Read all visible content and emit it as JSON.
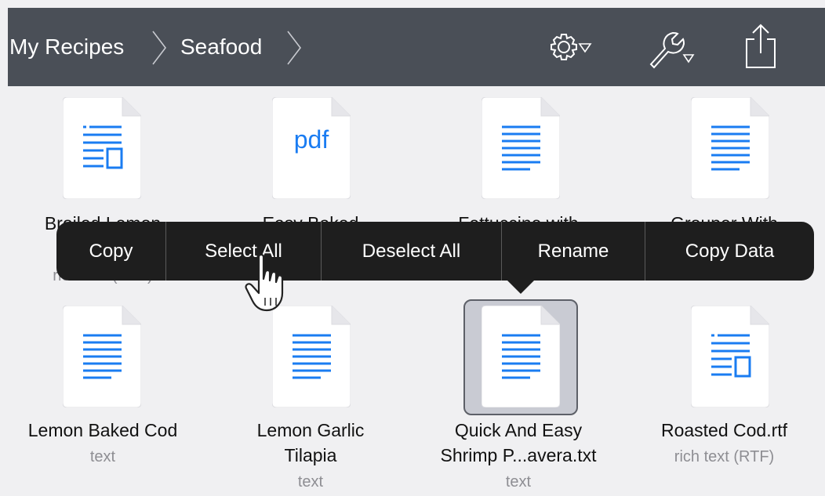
{
  "breadcrumb": {
    "items": [
      {
        "label": "My Recipes"
      },
      {
        "label": "Seafood"
      }
    ]
  },
  "toolbar": {
    "icons": [
      "gear-dropdown-icon",
      "wrench-dropdown-icon",
      "share-icon"
    ]
  },
  "files": [
    {
      "name_lines": [
        "Broiled Lemon"
      ],
      "type": "rich text (RTF)",
      "icon": "rich-text-doc-icon"
    },
    {
      "name_lines": [
        "Easy Baked"
      ],
      "type": "",
      "icon": "pdf-doc-icon",
      "icon_text": "pdf"
    },
    {
      "name_lines": [
        "Fettuccine with"
      ],
      "type": "",
      "icon": "text-doc-icon"
    },
    {
      "name_lines": [
        "Grouper With"
      ],
      "type": "",
      "icon": "text-doc-icon"
    },
    {
      "name_lines": [
        "Lemon Baked Cod"
      ],
      "type": "text",
      "icon": "text-doc-icon"
    },
    {
      "name_lines": [
        "Lemon Garlic",
        "Tilapia"
      ],
      "type": "text",
      "icon": "text-doc-icon"
    },
    {
      "name_lines": [
        "Quick And Easy",
        "Shrimp P...avera.txt"
      ],
      "type": "text",
      "icon": "text-doc-icon",
      "selected": true
    },
    {
      "name_lines": [
        "Roasted Cod.rtf"
      ],
      "type": "rich text (RTF)",
      "icon": "rich-text-doc-icon"
    }
  ],
  "context_menu": {
    "items": [
      {
        "label": "Copy"
      },
      {
        "label": "Select All"
      },
      {
        "label": "Deselect All"
      },
      {
        "label": "Rename"
      },
      {
        "label": "Copy Data"
      }
    ]
  },
  "colors": {
    "topbar": "#4a4f57",
    "accent": "#1a7cf2",
    "menu": "#1e1e1e",
    "background": "#f0f0f2"
  }
}
